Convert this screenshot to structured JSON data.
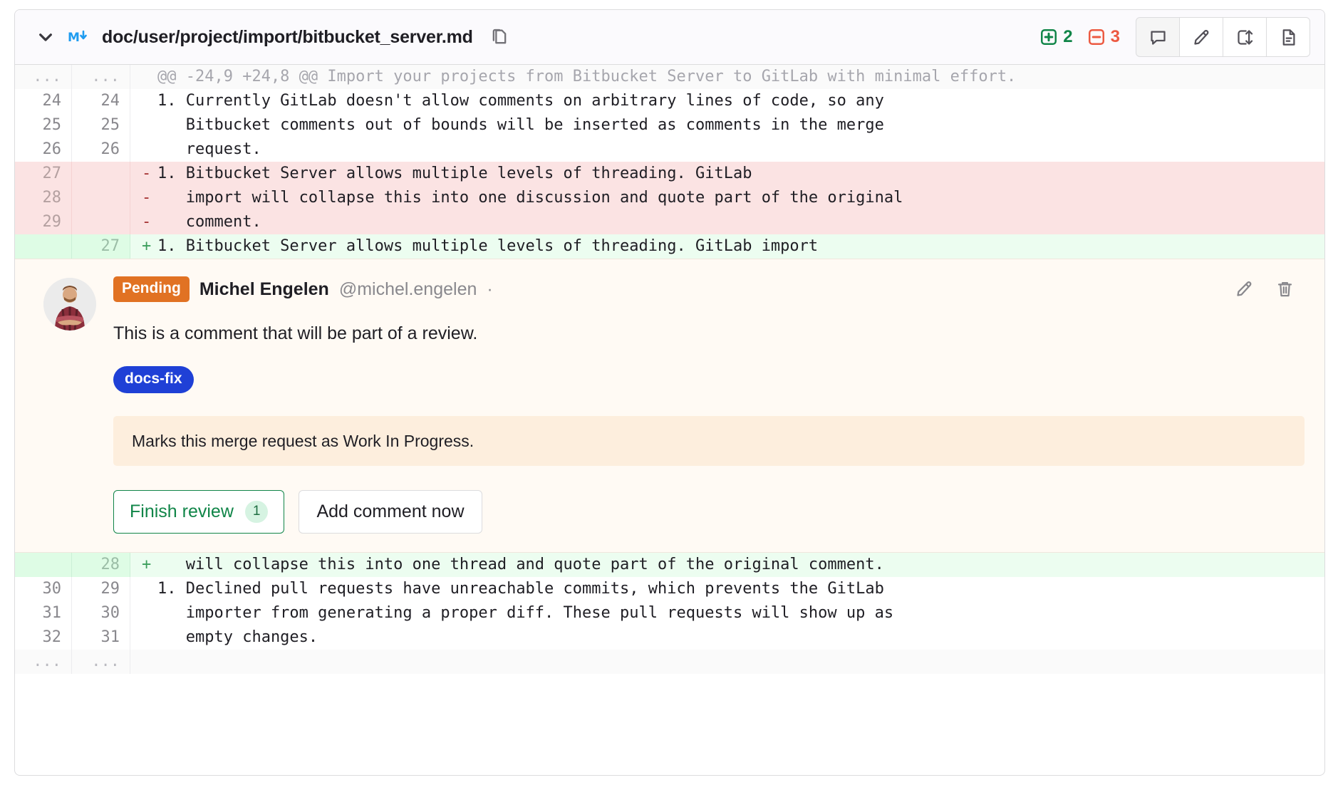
{
  "header": {
    "collapse_icon": "chevron-down-icon",
    "file_type_icon": "markdown-icon",
    "file_path": "doc/user/project/import/bitbucket_server.md",
    "copy_icon": "copy-path-icon",
    "additions": "2",
    "deletions": "3",
    "buttons": [
      {
        "name": "comment-on-file-button",
        "icon": "comment-icon"
      },
      {
        "name": "edit-file-button",
        "icon": "pencil-icon"
      },
      {
        "name": "toggle-file-view-button",
        "icon": "compare-arrows-icon"
      },
      {
        "name": "view-file-button",
        "icon": "document-icon"
      }
    ]
  },
  "diff": {
    "rows": [
      {
        "type": "meta",
        "old": "...",
        "new": "...",
        "sign": "",
        "code": "@@ -24,9 +24,8 @@ Import your projects from Bitbucket Server to GitLab with minimal effort."
      },
      {
        "type": "ctx",
        "old": "24",
        "new": "24",
        "sign": "",
        "code": "1. Currently GitLab doesn't allow comments on arbitrary lines of code, so any"
      },
      {
        "type": "ctx",
        "old": "25",
        "new": "25",
        "sign": "",
        "code": "   Bitbucket comments out of bounds will be inserted as comments in the merge"
      },
      {
        "type": "ctx",
        "old": "26",
        "new": "26",
        "sign": "",
        "code": "   request."
      },
      {
        "type": "del",
        "old": "27",
        "new": "",
        "sign": "-",
        "code": "1. Bitbucket Server allows multiple levels of threading. GitLab"
      },
      {
        "type": "del",
        "old": "28",
        "new": "",
        "sign": "-",
        "code": "   import will collapse this into one discussion and quote part of the original"
      },
      {
        "type": "del",
        "old": "29",
        "new": "",
        "sign": "-",
        "code": "   comment."
      },
      {
        "type": "add",
        "old": "",
        "new": "27",
        "sign": "+",
        "code": "1. Bitbucket Server allows multiple levels of threading. GitLab import"
      }
    ],
    "rows_after": [
      {
        "type": "add",
        "old": "",
        "new": "28",
        "sign": "+",
        "code": "   will collapse this into one thread and quote part of the original comment."
      },
      {
        "type": "ctx",
        "old": "30",
        "new": "29",
        "sign": "",
        "code": "1. Declined pull requests have unreachable commits, which prevents the GitLab"
      },
      {
        "type": "ctx",
        "old": "31",
        "new": "30",
        "sign": "",
        "code": "   importer from generating a proper diff. These pull requests will show up as"
      },
      {
        "type": "ctx",
        "old": "32",
        "new": "31",
        "sign": "",
        "code": "   empty changes."
      },
      {
        "type": "end",
        "old": "...",
        "new": "...",
        "sign": "",
        "code": ""
      }
    ]
  },
  "note": {
    "avatar_icon": "user-avatar",
    "pending_label": "Pending",
    "author_name": "Michel Engelen",
    "author_handle": "@michel.engelen",
    "separator": "·",
    "edit_icon": "pencil-icon",
    "delete_icon": "trash-icon",
    "body": "This is a comment that will be part of a review.",
    "label": "docs-fix",
    "system_note": "Marks this merge request as Work In Progress.",
    "finish_review_label": "Finish review",
    "finish_review_count": "1",
    "add_comment_label": "Add comment now"
  },
  "colors": {
    "addition": "#108548",
    "deletion": "#ec5941",
    "pending_badge": "#e17223",
    "label_chip": "#1f40d6",
    "markdown_icon": "#1f9cf0"
  }
}
